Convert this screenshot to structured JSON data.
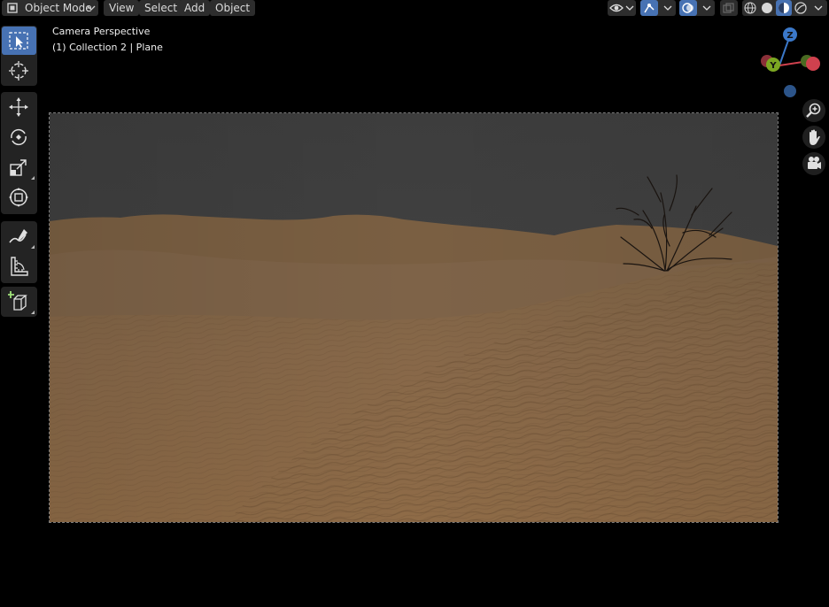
{
  "header": {
    "mode_label": "Object Mode",
    "menus": [
      "View",
      "Select",
      "Add",
      "Object"
    ]
  },
  "viewport": {
    "camera_label": "Camera Perspective",
    "object_label": "(1) Collection 2 | Plane"
  },
  "gizmo": {
    "z": "Z",
    "y": "Y"
  },
  "colors": {
    "accent": "#4772b3",
    "axis_x": "#d0414e",
    "axis_y": "#7ca722",
    "axis_z": "#3b78c9",
    "sky": "#3f3f3f",
    "sand": "#8a6a46"
  },
  "icons": {
    "toolbar": [
      "select-box-icon",
      "cursor-icon",
      "move-icon",
      "rotate-icon",
      "scale-icon",
      "transform-icon",
      "annotate-icon",
      "measure-icon",
      "add-cube-icon"
    ],
    "nav": [
      "zoom-icon",
      "pan-hand-icon",
      "camera-view-icon"
    ]
  }
}
